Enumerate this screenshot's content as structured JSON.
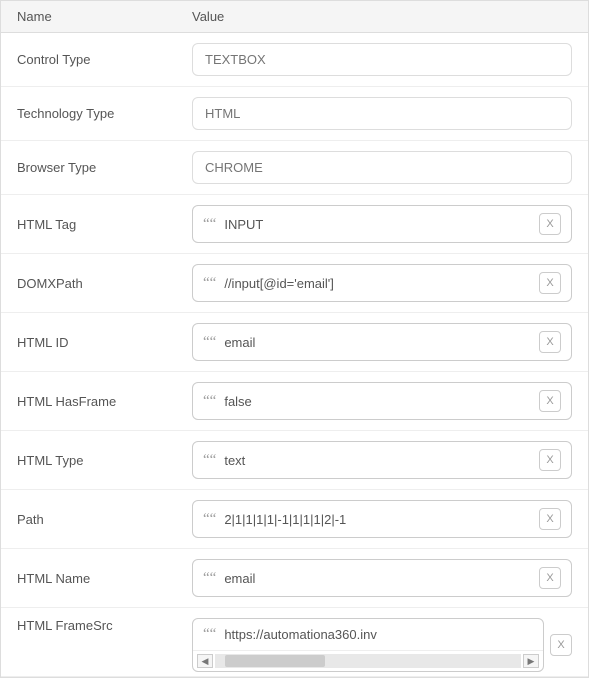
{
  "header": {
    "name_label": "Name",
    "value_label": "Value"
  },
  "rows": [
    {
      "id": "control-type",
      "name": "Control Type",
      "value": "TEXTBOX",
      "type": "plain"
    },
    {
      "id": "technology-type",
      "name": "Technology Type",
      "value": "HTML",
      "type": "plain"
    },
    {
      "id": "browser-type",
      "name": "Browser Type",
      "value": "CHROME",
      "type": "plain"
    },
    {
      "id": "html-tag",
      "name": "HTML Tag",
      "value": "INPUT",
      "type": "quote"
    },
    {
      "id": "domxpath",
      "name": "DOMXPath",
      "value": "//input[@id='email']",
      "type": "quote"
    },
    {
      "id": "html-id",
      "name": "HTML ID",
      "value": "email",
      "type": "quote"
    },
    {
      "id": "html-hasframe",
      "name": "HTML HasFrame",
      "value": "false",
      "type": "quote"
    },
    {
      "id": "html-type",
      "name": "HTML Type",
      "value": "text",
      "type": "quote"
    },
    {
      "id": "path",
      "name": "Path",
      "value": "2|1|1|1|1|-1|1|1|1|2|-1",
      "type": "quote"
    },
    {
      "id": "html-name",
      "name": "HTML Name",
      "value": "email",
      "type": "quote"
    },
    {
      "id": "html-framesrc",
      "name": "HTML FrameSrc",
      "value": "https://automationa360.inv",
      "type": "quote-scroll"
    }
  ],
  "icons": {
    "quote": "””",
    "x": "(x)",
    "arrow_left": "◄",
    "arrow_right": "►"
  }
}
